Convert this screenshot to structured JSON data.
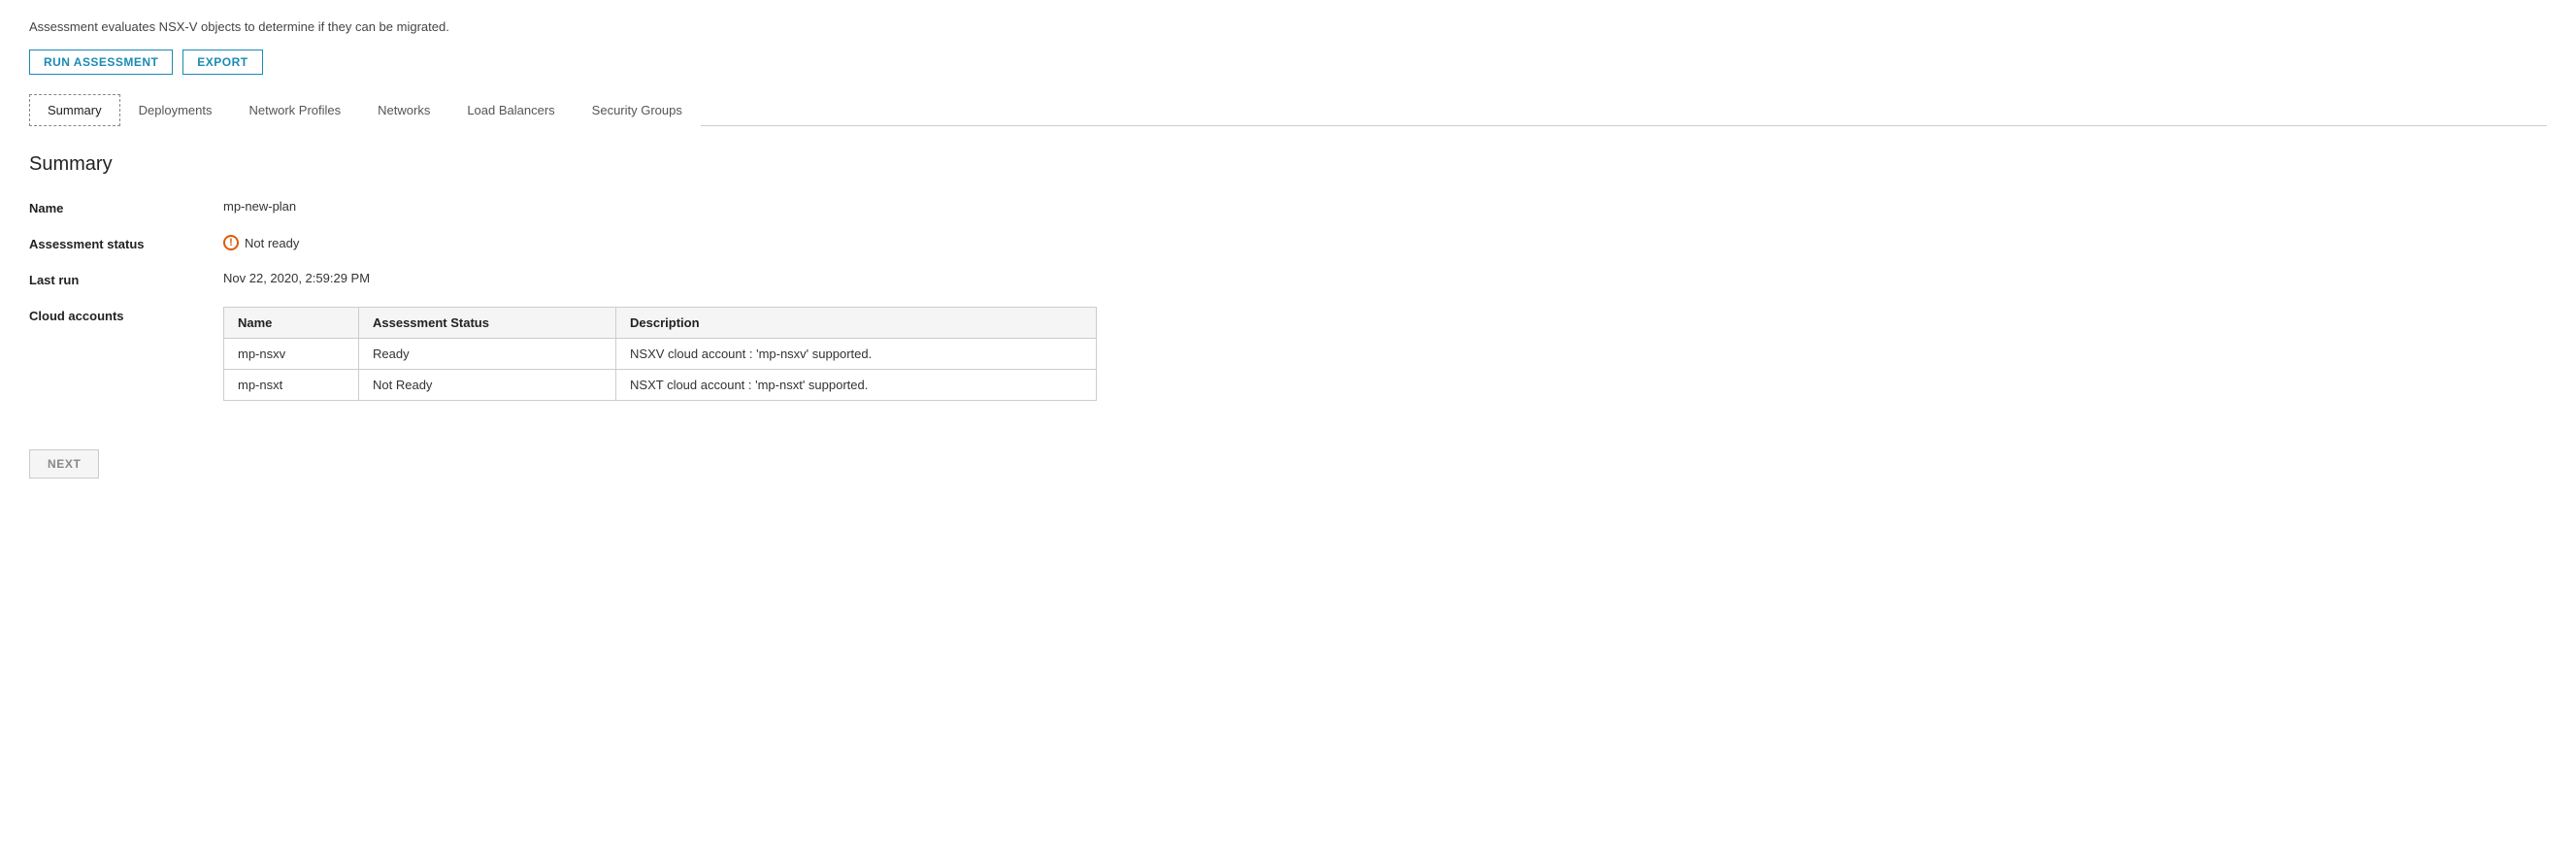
{
  "description": "Assessment evaluates NSX-V objects to determine if they can be migrated.",
  "toolbar": {
    "run_label": "RUN ASSESSMENT",
    "export_label": "EXPORT"
  },
  "tabs": [
    {
      "id": "summary",
      "label": "Summary",
      "active": true
    },
    {
      "id": "deployments",
      "label": "Deployments",
      "active": false
    },
    {
      "id": "network-profiles",
      "label": "Network Profiles",
      "active": false
    },
    {
      "id": "networks",
      "label": "Networks",
      "active": false
    },
    {
      "id": "load-balancers",
      "label": "Load Balancers",
      "active": false
    },
    {
      "id": "security-groups",
      "label": "Security Groups",
      "active": false
    }
  ],
  "section": {
    "title": "Summary",
    "fields": {
      "name_label": "Name",
      "name_value": "mp-new-plan",
      "status_label": "Assessment status",
      "status_value": "Not ready",
      "last_run_label": "Last run",
      "last_run_value": "Nov 22, 2020, 2:59:29 PM",
      "cloud_accounts_label": "Cloud accounts"
    },
    "table": {
      "headers": [
        "Name",
        "Assessment Status",
        "Description"
      ],
      "rows": [
        {
          "name": "mp-nsxv",
          "assessment_status": "Ready",
          "description": "NSXV cloud account : 'mp-nsxv' supported."
        },
        {
          "name": "mp-nsxt",
          "assessment_status": "Not Ready",
          "description": "NSXT cloud account : 'mp-nsxt' supported."
        }
      ]
    }
  },
  "next_button_label": "NEXT"
}
